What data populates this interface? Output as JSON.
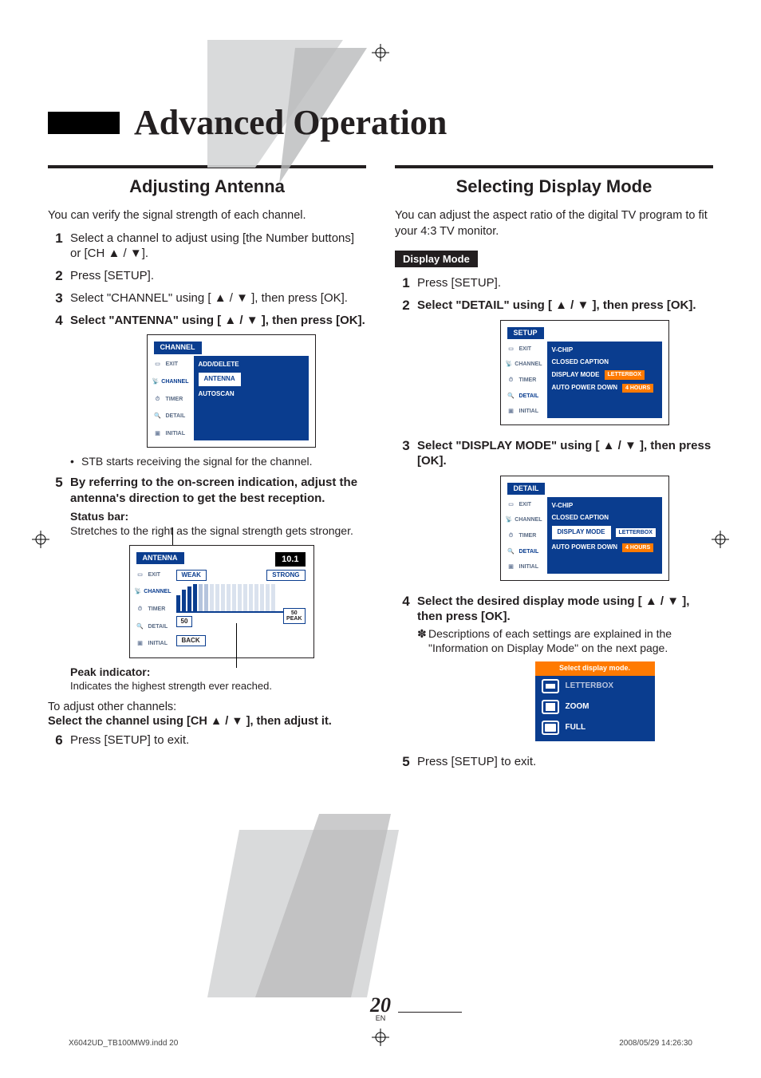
{
  "chapter_title": "Advanced Operation",
  "left": {
    "heading": "Adjusting Antenna",
    "intro": "You can verify the signal strength of each channel.",
    "steps": {
      "s1": "Select a channel to adjust using [the Number buttons] or [CH ▲ / ▼].",
      "s2": "Press [SETUP].",
      "s3": "Select \"CHANNEL\" using [ ▲ / ▼ ], then press [OK].",
      "s4": "Select \"ANTENNA\" using [ ▲ / ▼ ], then press [OK].",
      "s4_bullet": "STB starts receiving the signal for the channel.",
      "s5": "By referring to the on-screen indication, adjust the antenna's direction to get the best reception.",
      "s5_note_label": "Status bar:",
      "s5_note_text": "Stretches to the right as the signal strength gets stronger.",
      "s5_peak_label": "Peak indicator:",
      "s5_peak_text": "Indicates the highest strength ever reached.",
      "between1": "To adjust other channels:",
      "between2": "Select the channel using [CH ▲ / ▼ ], then adjust it.",
      "s6": "Press [SETUP] to exit."
    },
    "osd_channel": {
      "title": "CHANNEL",
      "items": [
        "ADD/DELETE",
        "ANTENNA",
        "AUTOSCAN"
      ]
    },
    "osd_side": {
      "items": [
        "EXIT",
        "CHANNEL",
        "TIMER",
        "DETAIL",
        "INITIAL"
      ]
    },
    "osd_antenna": {
      "title": "ANTENNA",
      "ch": "10.1",
      "weak": "WEAK",
      "strong": "STRONG",
      "cur": "50",
      "peak_val": "50",
      "peak_lbl": "PEAK",
      "back": "BACK"
    }
  },
  "right": {
    "heading": "Selecting Display Mode",
    "intro": "You can adjust the aspect ratio of the digital TV program to fit your 4:3 TV monitor.",
    "tab": "Display Mode",
    "steps": {
      "s1": "Press [SETUP].",
      "s2": "Select \"DETAIL\" using [ ▲ / ▼ ], then press [OK].",
      "s3": "Select \"DISPLAY MODE\" using [ ▲ / ▼ ], then press [OK].",
      "s4": "Select the desired display mode using [ ▲ / ▼ ], then press [OK].",
      "s4_note": "Descriptions of each settings are explained in the \"Information on Display Mode\" on the next page.",
      "s5": "Press [SETUP] to exit."
    },
    "osd_setup": {
      "title": "SETUP",
      "rows": {
        "vchip": "V-CHIP",
        "cc": "CLOSED CAPTION",
        "disp": "DISPLAY MODE",
        "disp_val": "LETTERBOX",
        "apd": "AUTO POWER DOWN",
        "apd_val": "4 HOURS"
      }
    },
    "osd_detail": {
      "title": "DETAIL"
    },
    "osd_select": {
      "header": "Select display mode.",
      "opts": [
        "LETTERBOX",
        "ZOOM",
        "FULL"
      ]
    }
  },
  "page_number": "20",
  "page_lang": "EN",
  "footer_left": "X6042UD_TB100MW9.indd   20",
  "footer_right": "2008/05/29   14:26:30"
}
